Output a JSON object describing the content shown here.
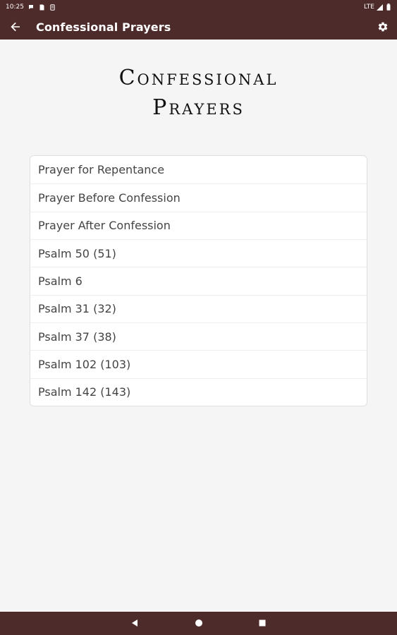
{
  "status_bar": {
    "time": "10:25",
    "network": "LTE"
  },
  "app_bar": {
    "title": "Confessional Prayers",
    "icons": [
      "back-arrow-icon",
      "gear-icon"
    ]
  },
  "heading": {
    "line1": "Confessional",
    "line2": "Prayers"
  },
  "prayer_list": [
    {
      "label": "Prayer for Repentance"
    },
    {
      "label": "Prayer Before Confession"
    },
    {
      "label": "Prayer After Confession"
    },
    {
      "label": "Psalm 50 (51)"
    },
    {
      "label": "Psalm 6"
    },
    {
      "label": "Psalm 31 (32)"
    },
    {
      "label": "Psalm 37 (38)"
    },
    {
      "label": "Psalm 102 (103)"
    },
    {
      "label": "Psalm 142 (143)"
    }
  ],
  "colors": {
    "bar_background": "#4e2b2b",
    "content_background": "#f5f5f5",
    "card_background": "#ffffff",
    "list_text": "#444444"
  }
}
